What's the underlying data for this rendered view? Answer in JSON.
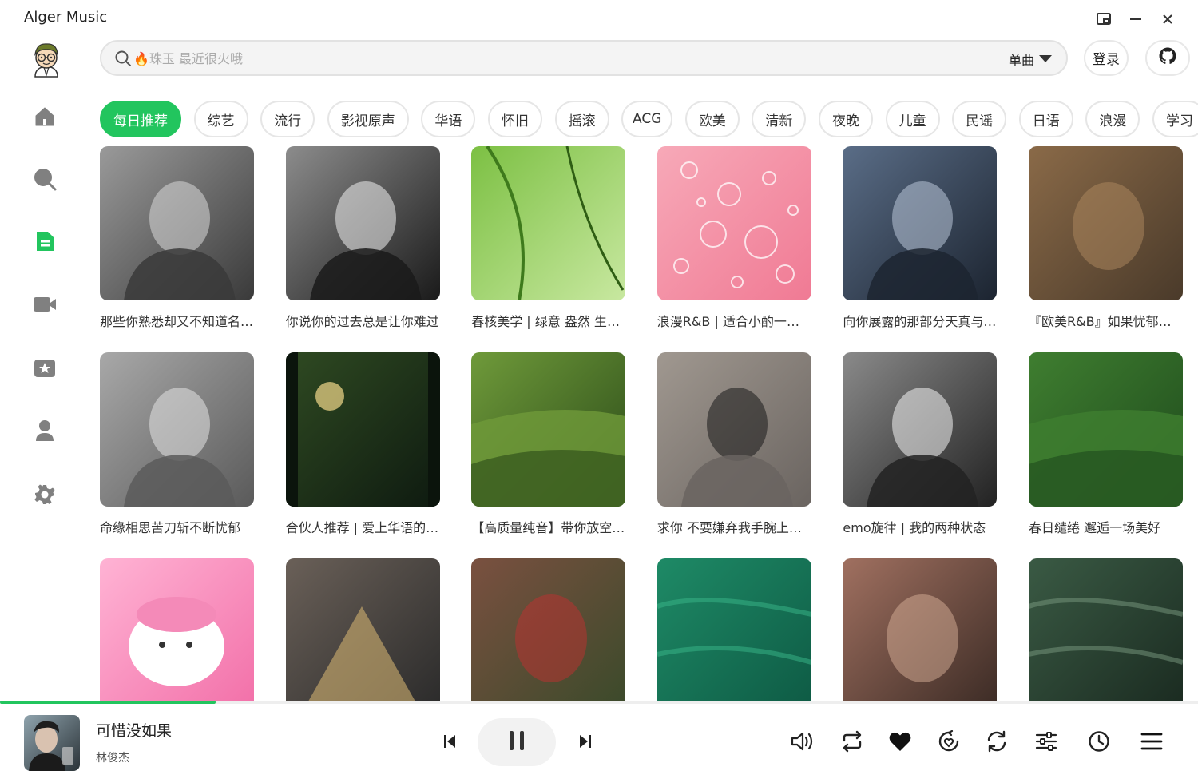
{
  "app": {
    "title": "Alger Music"
  },
  "header": {
    "search_placeholder": "🔥珠玉 最近很火哦",
    "search_type": "单曲",
    "login_label": "登录"
  },
  "sidebar": {
    "items": [
      {
        "name": "home",
        "icon": "home-icon",
        "active": false
      },
      {
        "name": "search",
        "icon": "search-icon",
        "active": false
      },
      {
        "name": "playlist",
        "icon": "playlist-icon",
        "active": true
      },
      {
        "name": "mv",
        "icon": "video-icon",
        "active": false
      },
      {
        "name": "favorite",
        "icon": "star-icon",
        "active": false
      },
      {
        "name": "user",
        "icon": "user-icon",
        "active": false
      },
      {
        "name": "settings",
        "icon": "gear-icon",
        "active": false
      }
    ]
  },
  "categories": [
    "每日推荐",
    "综艺",
    "流行",
    "影视原声",
    "华语",
    "怀旧",
    "摇滚",
    "ACG",
    "欧美",
    "清新",
    "夜晚",
    "儿童",
    "民谣",
    "日语",
    "浪漫",
    "学习"
  ],
  "active_category": 0,
  "playlists": [
    {
      "title": "那些你熟悉却又不知道名字的歌"
    },
    {
      "title": "你说你的过去总是让你难过"
    },
    {
      "title": "春核美学 | 绿意 盎然 生机勃勃"
    },
    {
      "title": "浪漫R&B | 适合小酌一杯的夜晚"
    },
    {
      "title": "向你展露的那部分天真与温柔"
    },
    {
      "title": "『欧美R&B』如果忧郁有声音"
    },
    {
      "title": "命缘相思苦刀斩不断忧郁"
    },
    {
      "title": "合伙人推荐 | 爱上华语的理由"
    },
    {
      "title": "【高质量纯音】带你放空自己"
    },
    {
      "title": "求你 不要嫌弃我手腕上的伤"
    },
    {
      "title": "emo旋律 | 我的两种状态"
    },
    {
      "title": "春日缱绻 邂逅一场美好"
    },
    {
      "title": ""
    },
    {
      "title": ""
    },
    {
      "title": ""
    },
    {
      "title": ""
    },
    {
      "title": ""
    },
    {
      "title": ""
    }
  ],
  "player": {
    "song_title": "可惜没如果",
    "artist": "林俊杰",
    "progress": 0.18,
    "accent": "#22c55e"
  }
}
